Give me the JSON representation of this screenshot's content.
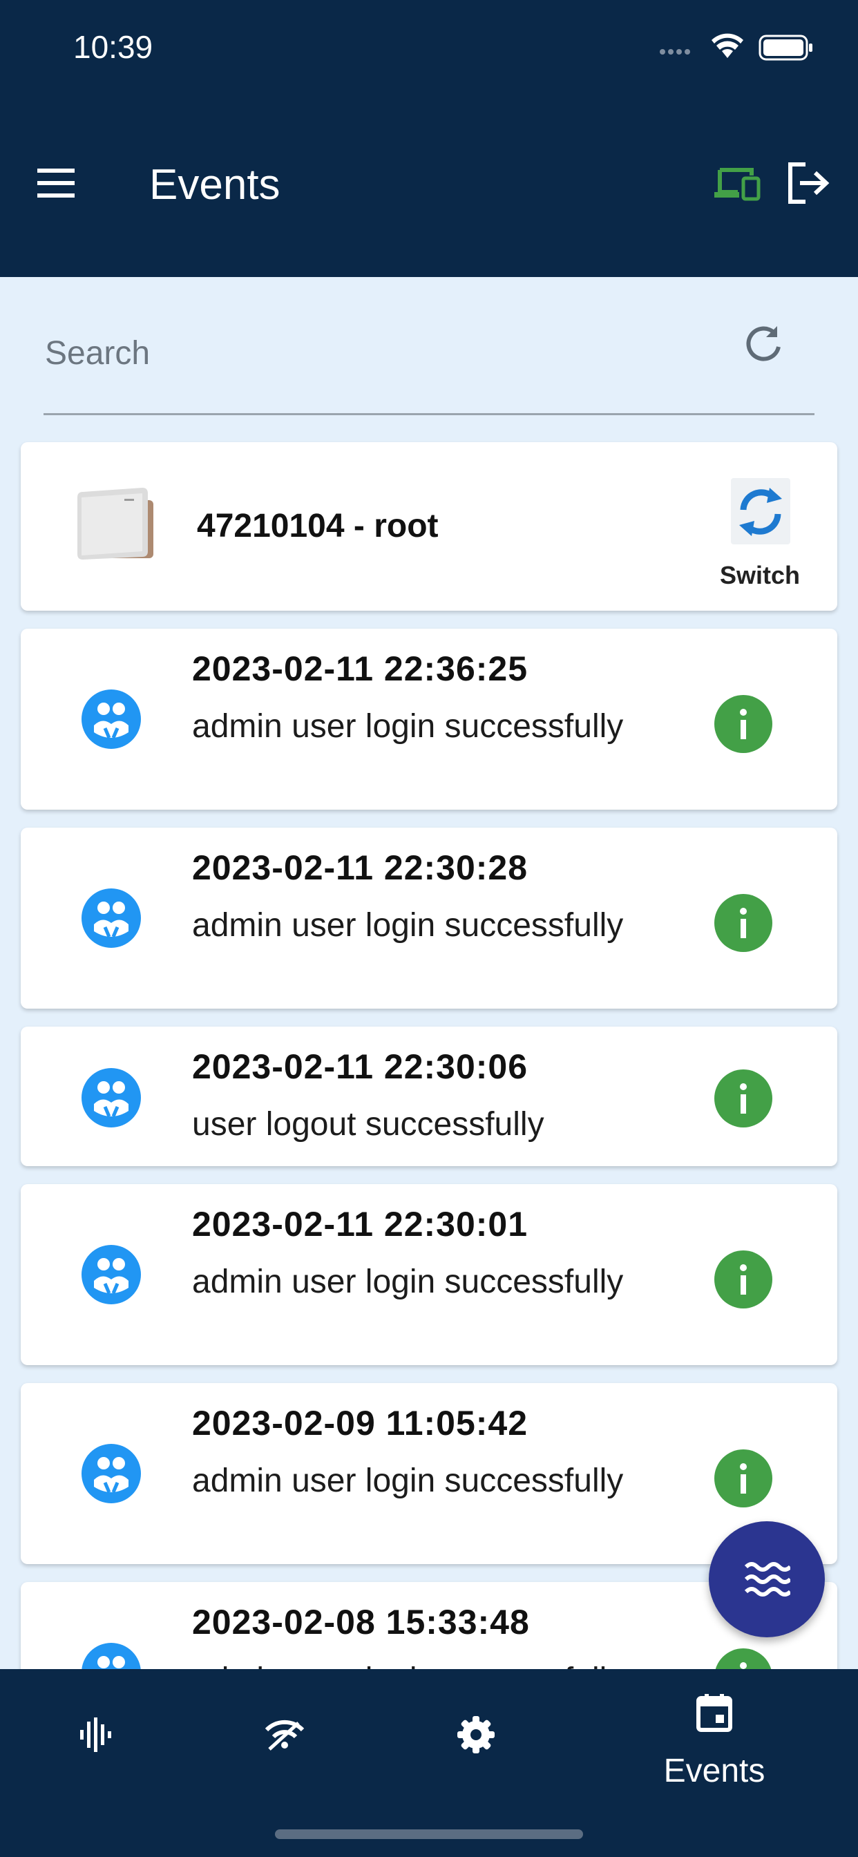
{
  "status_bar": {
    "time": "10:39"
  },
  "header": {
    "title": "Events"
  },
  "search": {
    "placeholder": "Search"
  },
  "device": {
    "label": "47210104 - root",
    "switch_label": "Switch"
  },
  "events": [
    {
      "time": "2023-02-11 22:36:25",
      "message": "admin user login successfully",
      "level": "info"
    },
    {
      "time": "2023-02-11 22:30:28",
      "message": "admin user login successfully",
      "level": "info"
    },
    {
      "time": "2023-02-11 22:30:06",
      "message": "user logout successfully",
      "level": "info"
    },
    {
      "time": "2023-02-11 22:30:01",
      "message": "admin user login successfully",
      "level": "info"
    },
    {
      "time": "2023-02-09 11:05:42",
      "message": "admin user login successfully",
      "level": "info"
    },
    {
      "time": "2023-02-08 15:33:48",
      "message": "admin user login successfully",
      "level": "info"
    }
  ],
  "bottom_nav": {
    "items": [
      {
        "icon": "signal-wave-icon",
        "label": ""
      },
      {
        "icon": "wifi-off-icon",
        "label": ""
      },
      {
        "icon": "gear-icon",
        "label": ""
      },
      {
        "icon": "calendar-icon",
        "label": "Events"
      }
    ]
  },
  "colors": {
    "app_bar": "#0a2848",
    "background": "#e4f0fb",
    "accent_blue": "#2196f3",
    "info_green": "#43a047",
    "fab": "#2b3590"
  }
}
